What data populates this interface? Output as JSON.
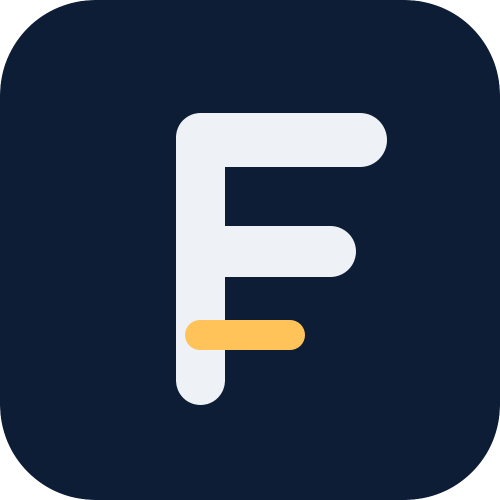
{
  "icon": {
    "name": "app-icon-letter-f",
    "colors": {
      "background": "#0E1D36",
      "letter": "#EEF2F6",
      "accent": "#FFC35A"
    }
  }
}
